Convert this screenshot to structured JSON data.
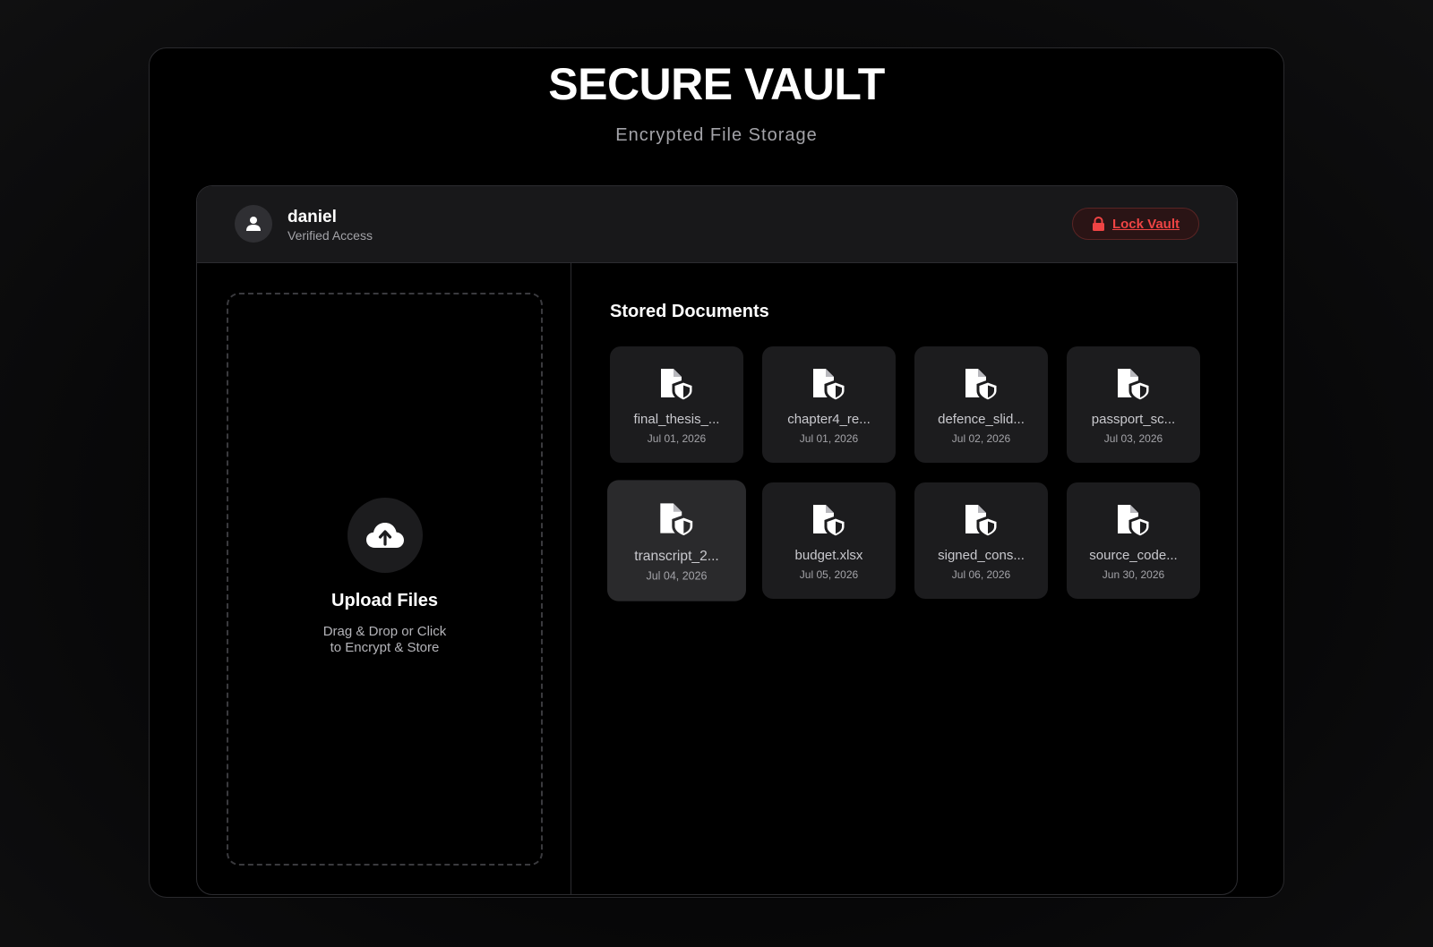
{
  "app": {
    "title": "SECURE VAULT",
    "subtitle": "Encrypted File Storage"
  },
  "user": {
    "name": "daniel",
    "status": "Verified Access",
    "avatar_icon": "user-icon"
  },
  "lock_button": {
    "label": "Lock Vault",
    "icon": "lock-icon",
    "color": "#ef4444"
  },
  "upload": {
    "icon": "cloud-upload-icon",
    "title": "Upload Files",
    "hint_line1": "Drag & Drop or Click",
    "hint_line2": "to Encrypt & Store"
  },
  "documents": {
    "title": "Stored Documents",
    "icon": "secure-file-icon",
    "items": [
      {
        "name": "final_thesis_...",
        "date": "Jul 01, 2026"
      },
      {
        "name": "chapter4_re...",
        "date": "Jul 01, 2026"
      },
      {
        "name": "defence_slid...",
        "date": "Jul 02, 2026"
      },
      {
        "name": "passport_sc...",
        "date": "Jul 03, 2026"
      },
      {
        "name": "transcript_2...",
        "date": "Jul 04, 2026"
      },
      {
        "name": "budget.xlsx",
        "date": "Jul 05, 2026"
      },
      {
        "name": "signed_cons...",
        "date": "Jul 06, 2026"
      },
      {
        "name": "source_code...",
        "date": "Jun 30, 2026"
      }
    ]
  }
}
